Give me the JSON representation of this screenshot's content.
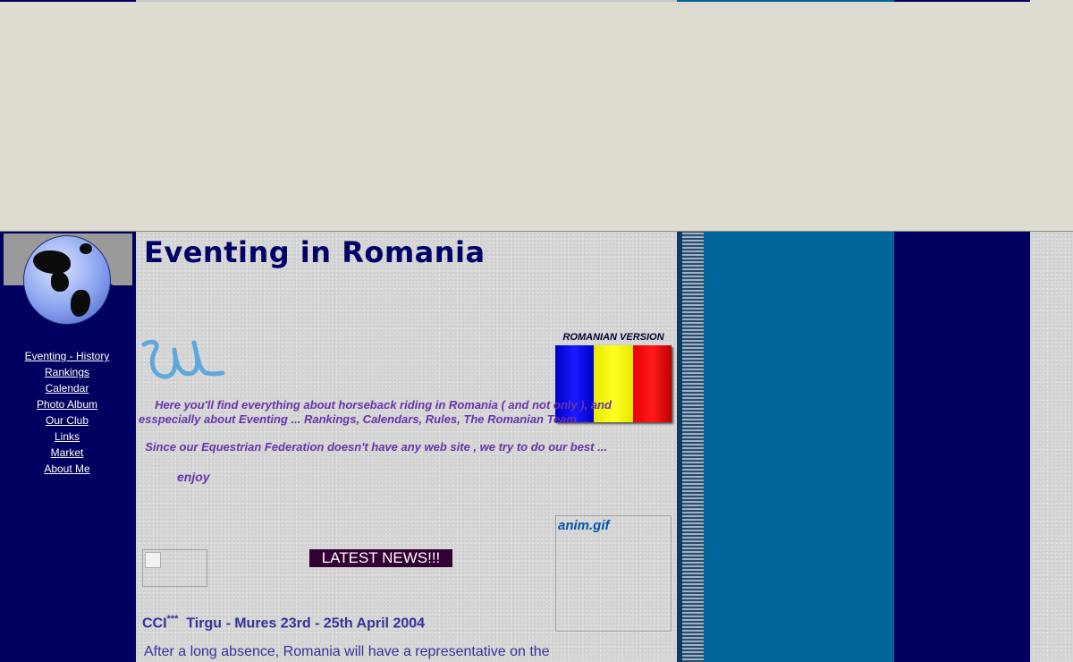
{
  "page": {
    "title": "Eventing in Romania"
  },
  "sidebar": {
    "items": [
      {
        "label": "Eventing - History"
      },
      {
        "label": "Rankings"
      },
      {
        "label": "Calendar"
      },
      {
        "label": "Photo Album"
      },
      {
        "label": "Our Club"
      },
      {
        "label": "Links"
      },
      {
        "label": "Market"
      },
      {
        "label": "About Me"
      }
    ]
  },
  "romanian_version": {
    "label": "ROMANIAN VERSION"
  },
  "intro": {
    "paragraph": "Here you'll find everything about horseback riding in Romania ( and not only ), and esspecially about Eventing ... Rankings, Calendars, Rules, The Romanian Team ...",
    "federation_note": "Since our Equestrian Federation doesn't have any web site , we try to do our best ...",
    "enjoy": "enjoy"
  },
  "anim_image": {
    "alt": "anim.gif"
  },
  "news": {
    "banner": "LATEST NEWS!!!",
    "event_prefix": "CCI",
    "event_stars": "***",
    "event_title": "Tirgu - Mures 23rd - 25th April 2004",
    "body": "After a long absence, Romania will have a representative on the"
  },
  "colors": {
    "page_bg": "#dedbd0",
    "sidebar_bg": "#000060",
    "teal_column": "#006699",
    "title": "#000066",
    "intro_text": "#6633aa",
    "news_text": "#333399",
    "news_banner_bg": "#330033",
    "flag_blue": "#0000ff",
    "flag_yellow": "#ffff00",
    "flag_red": "#ff0000"
  },
  "icons": [
    "globe-icon",
    "w-initial-icon",
    "romanian-flag-icon",
    "broken-image-icon"
  ]
}
